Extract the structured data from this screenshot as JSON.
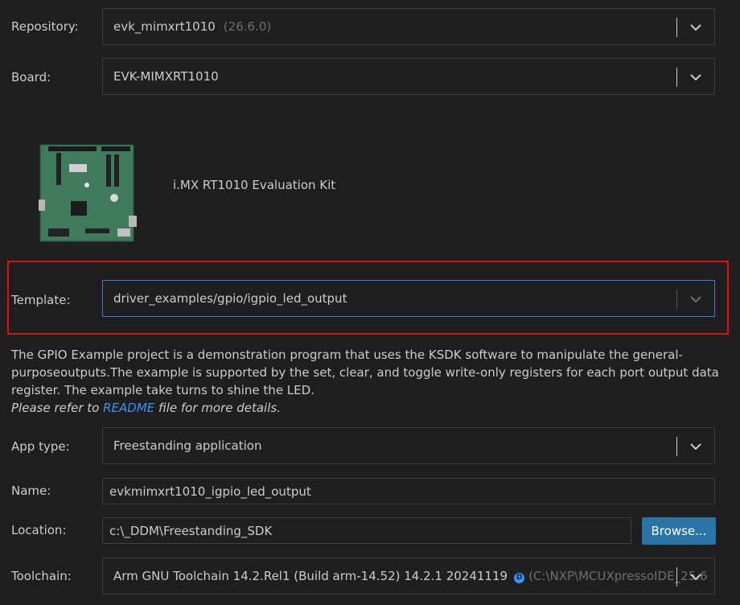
{
  "repository": {
    "label": "Repository:",
    "value": "evk_mimxrt1010",
    "version": "(26.6.0)"
  },
  "board": {
    "label": "Board:",
    "value": "EVK-MIMXRT1010",
    "name": "i.MX RT1010 Evaluation Kit"
  },
  "template": {
    "label": "Template:",
    "value": "driver_examples/gpio/igpio_led_output"
  },
  "description": {
    "line1": "The GPIO Example project is a demonstration program that uses the KSDK software to manipulate the general-",
    "line2": "purposeoutputs.The example is supported by the set, clear, and toggle write-only registers for each port output data",
    "line3": "register. The example take turns to shine the LED.",
    "note_prefix": "Please refer to ",
    "note_link": "README",
    "note_suffix": " file for more details."
  },
  "app_type": {
    "label": "App type:",
    "value": "Freestanding application"
  },
  "name": {
    "label": "Name:",
    "value": "evkmimxrt1010_igpio_led_output"
  },
  "location": {
    "label": "Location:",
    "value": "c:\\_DDM\\Freestanding_SDK",
    "browse_label": "Browse..."
  },
  "toolchain": {
    "label": "Toolchain:",
    "value": "Arm GNU Toolchain 14.2.Rel1 (Build arm-14.52) 14.2.1 20241119",
    "badge": "D",
    "path": "(C:\\NXP\\MCUXpressoIDE_25.6"
  },
  "colors": {
    "background": "#1e1e1e",
    "focus_border": "#3c7bd4",
    "highlight_border": "#e01010",
    "browse_button": "#2a75a8",
    "link": "#3794ff"
  }
}
